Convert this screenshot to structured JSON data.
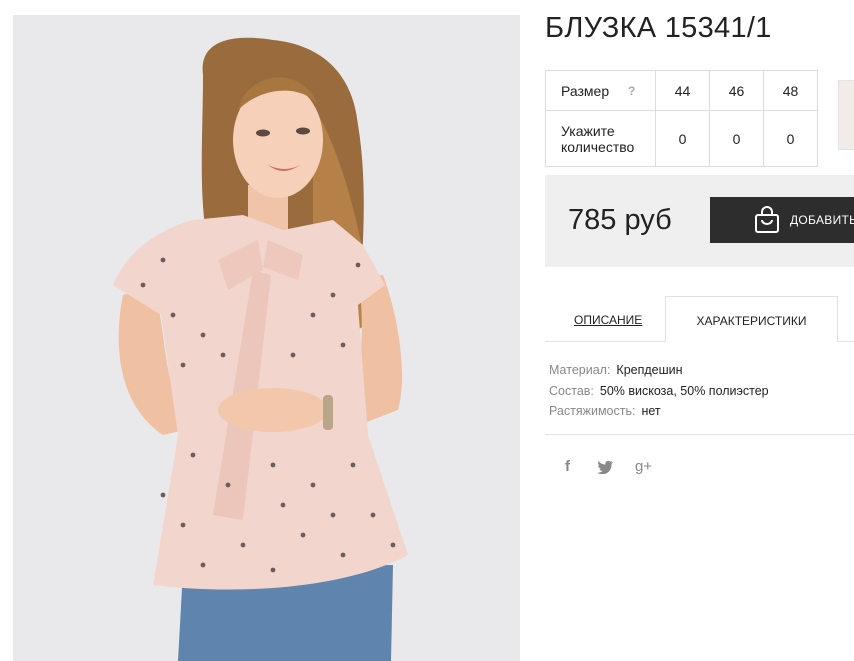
{
  "product": {
    "title": "БЛУЗКА 15341/1",
    "image_alt": "product-photo-blouse"
  },
  "size_table": {
    "size_label": "Размер",
    "help_symbol": "?",
    "sizes": [
      "44",
      "46",
      "48"
    ],
    "qty_label": "Укажите количество",
    "quantities": [
      "0",
      "0",
      "0"
    ]
  },
  "purchase": {
    "price": "785 руб",
    "add_to_cart_label": "ДОБАВИТЬ"
  },
  "tabs": {
    "description_label": "ОПИСАНИЕ",
    "characteristics_label": "ХАРАКТЕРИСТИКИ",
    "active": "characteristics"
  },
  "specs": [
    {
      "key": "Материал:",
      "value": "Крепдешин"
    },
    {
      "key": "Состав:",
      "value": "50% вискоза, 50% полиэстер"
    },
    {
      "key": "Растяжимость:",
      "value": "нет"
    }
  ],
  "social": {
    "facebook": "f",
    "twitter": "twitter-bird",
    "googleplus": "g+"
  },
  "colors": {
    "photo_bg": "#e9e9eb",
    "price_bg": "#efefef",
    "button_bg": "#2d2d2d",
    "blouse": "#f2d5cc"
  }
}
